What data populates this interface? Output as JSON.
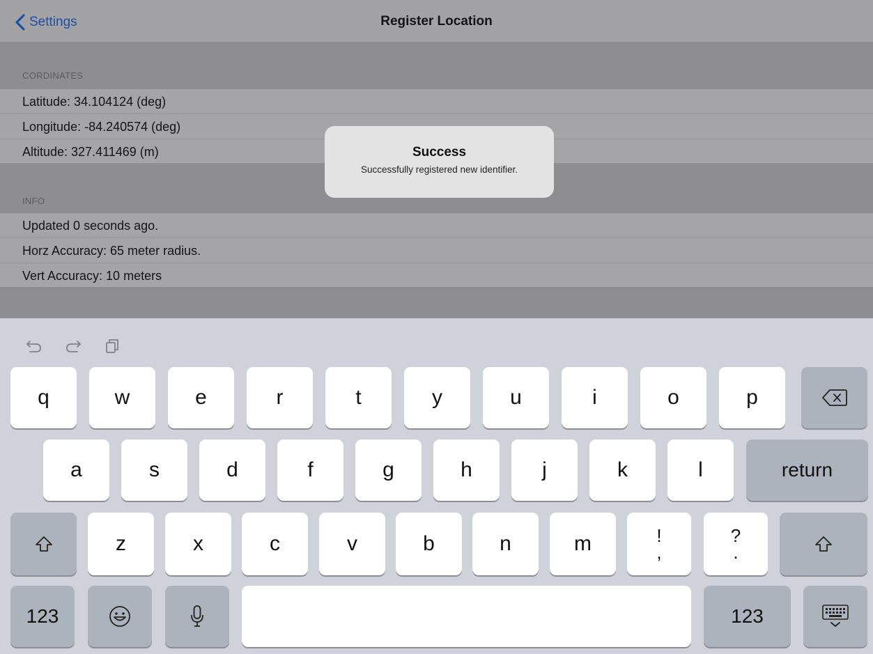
{
  "navbar": {
    "back_label": "Settings",
    "title": "Register Location"
  },
  "coordinates": {
    "header": "CORDINATES",
    "rows": [
      "Latitude: 34.104124 (deg)",
      "Longitude: -84.240574 (deg)",
      "Altitude: 327.411469 (m)"
    ]
  },
  "info": {
    "header": "INFO",
    "rows": [
      "Updated 0 seconds ago.",
      "Horz Accuracy: 65 meter radius.",
      "Vert Accuracy: 10 meters"
    ]
  },
  "alert": {
    "title": "Success",
    "message": "Successfully registered new identifier."
  },
  "keyboard": {
    "toolbar_icons": [
      "undo-icon",
      "redo-icon",
      "paste-icon"
    ],
    "row1": [
      "q",
      "w",
      "e",
      "r",
      "t",
      "y",
      "u",
      "i",
      "o",
      "p"
    ],
    "row2": [
      "a",
      "s",
      "d",
      "f",
      "g",
      "h",
      "j",
      "k",
      "l"
    ],
    "row3": [
      "z",
      "x",
      "c",
      "v",
      "b",
      "n",
      "m"
    ],
    "punct1_top": "!",
    "punct1_bottom": ",",
    "punct2_top": "?",
    "punct2_bottom": ".",
    "return_label": "return",
    "numbers_label": "123",
    "icons": [
      "delete-icon",
      "shift-icon",
      "emoji-icon",
      "microphone-icon",
      "keyboard-dismiss-icon"
    ]
  },
  "colors": {
    "accent": "#1f4fa0",
    "keyboard_bg": "#cfd3d9",
    "key_light": "#ffffff",
    "key_dark": "#acb3bd"
  }
}
